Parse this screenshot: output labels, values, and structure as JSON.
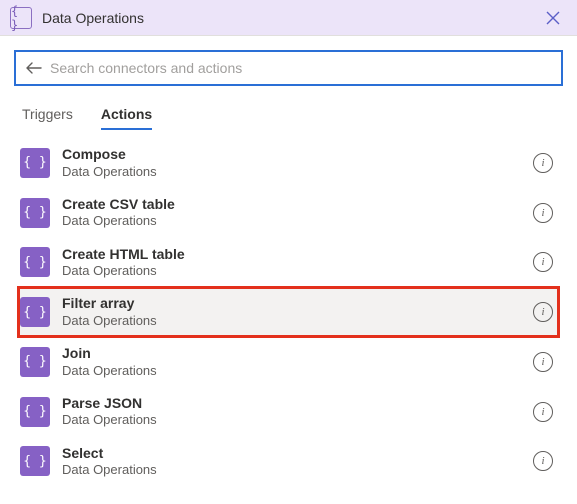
{
  "header": {
    "title": "Data Operations",
    "icon_glyph": "{ }"
  },
  "search": {
    "placeholder": "Search connectors and actions",
    "value": ""
  },
  "tabs": {
    "triggers": "Triggers",
    "actions": "Actions",
    "active": "actions"
  },
  "connector_name": "Data Operations",
  "action_icon_glyph": "{ }",
  "actions": [
    {
      "name": "Compose",
      "subtitle": "Data Operations",
      "selected": false,
      "highlighted": false
    },
    {
      "name": "Create CSV table",
      "subtitle": "Data Operations",
      "selected": false,
      "highlighted": false
    },
    {
      "name": "Create HTML table",
      "subtitle": "Data Operations",
      "selected": false,
      "highlighted": false
    },
    {
      "name": "Filter array",
      "subtitle": "Data Operations",
      "selected": true,
      "highlighted": true
    },
    {
      "name": "Join",
      "subtitle": "Data Operations",
      "selected": false,
      "highlighted": false
    },
    {
      "name": "Parse JSON",
      "subtitle": "Data Operations",
      "selected": false,
      "highlighted": false
    },
    {
      "name": "Select",
      "subtitle": "Data Operations",
      "selected": false,
      "highlighted": false
    }
  ],
  "colors": {
    "header_bg": "#ece4f9",
    "accent": "#2a6fd6",
    "icon_bg": "#8661c5",
    "highlight_border": "#e3301c"
  }
}
